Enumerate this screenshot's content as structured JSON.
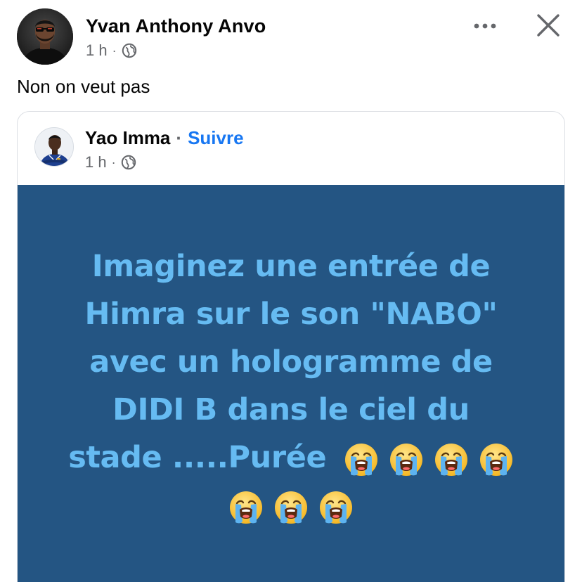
{
  "post": {
    "author": "Yvan Anthony Anvo",
    "time": "1 h",
    "separator": "·",
    "caption": "Non on veut pas"
  },
  "shared_post": {
    "author": "Yao Imma",
    "separator": "·",
    "follow_label": "Suivre",
    "time": "1 h",
    "text_lines": [
      "Imaginez une entrée de",
      "Himra sur le son \"NABO\"",
      "avec un hologramme de",
      "DIDI B dans le ciel du",
      "stade .....Purée"
    ],
    "emoji": "loudly-crying-face-emoji",
    "emoji_count_line5": 4,
    "emoji_count_line6": 3
  },
  "icons": {
    "globe": "globe-icon",
    "more": "more-options-icon",
    "close": "close-icon"
  },
  "colors": {
    "background_post": "#245583",
    "text_post": "#66bbf2",
    "link": "#1877f2",
    "secondary_text": "#65676b"
  }
}
